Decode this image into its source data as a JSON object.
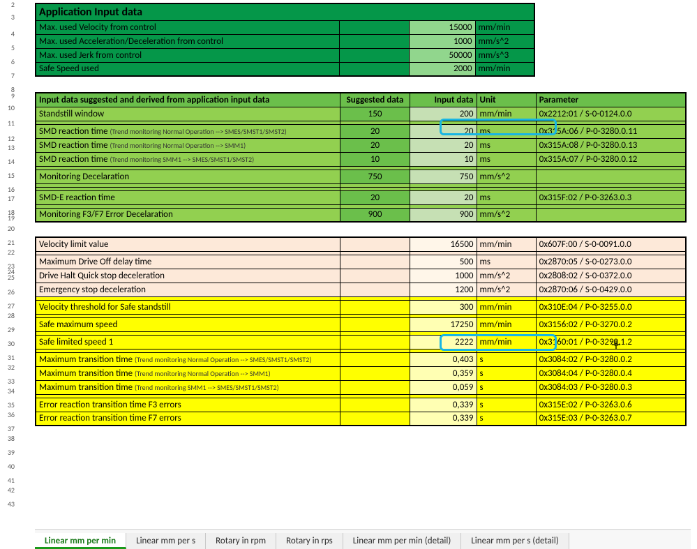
{
  "row_numbers": {
    "2": 0,
    "3": 14,
    "4": 38,
    "5": 58,
    "6": 78,
    "7": 98,
    "10": 156,
    "11": 178,
    "13": 212,
    "14": 232,
    "15": 252,
    "17": 286,
    "20": 330,
    "22": 364,
    "26": 434,
    "28": 468,
    "29": 488,
    "30": 508,
    "32": 542,
    "34": 576,
    "36": 610,
    "38": 644,
    "39": 664,
    "40": 684,
    "43": 740
  },
  "row_numbers_dense": {
    "8": 118,
    "9": 126,
    "12": 198,
    "16": 272,
    "18": 306,
    "19": 314,
    "21": 350,
    "23": 384,
    "24": 392,
    "25": 400,
    "27": 454,
    "31": 528,
    "33": 562,
    "35": 596,
    "37": 630,
    "41": 704,
    "42": 718
  },
  "appTitle": "Application Input data",
  "app": {
    "velocity": {
      "label": "Max. used Velocity from control",
      "value": "15000",
      "unit": "mm/min"
    },
    "accel": {
      "label": "Max. used Acceleration/Deceleration from control",
      "value": "1000",
      "unit": "mm/s^2"
    },
    "jerk": {
      "label": "Max. used Jerk from control",
      "value": "50000",
      "unit": "mm/s^3"
    },
    "safeSpeed": {
      "label": "Safe Speed used",
      "value": "2000",
      "unit": "mm/min"
    }
  },
  "derivedHeader": {
    "title": "Input data suggested and derived from application input data",
    "c1": "Suggested data",
    "c2": "Input data",
    "c3": "Unit",
    "c4": "Parameter"
  },
  "g": {
    "standstill": {
      "label": "Standstill window",
      "sug": "150",
      "inp": "200",
      "unit": "mm/min",
      "par": "0x2212:01 / S-0-0124.0.0"
    },
    "smd1": {
      "label": "SMD reaction time ",
      "note": "(Trend monitoring Normal Operation --> SMES/SMST1/SMST2)",
      "sug": "20",
      "inp": "20",
      "unit": "ms",
      "par": "0x315A:06 / P-0-3280.0.11"
    },
    "smd2": {
      "label": "SMD reaction time ",
      "note": "(Trend monitoring Normal Operation --> SMM1)",
      "sug": "20",
      "inp": "20",
      "unit": "ms",
      "par": "0x315A:08 / P-0-3280.0.13"
    },
    "smd3": {
      "label": "SMD reaction time ",
      "note": "(Trend monitoring SMM1 --> SMES/SMST1/SMST2)",
      "sug": "10",
      "inp": "10",
      "unit": "ms",
      "par": "0x315A:07 / P-0-3280.0.12"
    },
    "monDecel": {
      "label": "Monitoring Decelaration",
      "sug": "750",
      "inp": "750",
      "unit": "mm/s^2",
      "par": ""
    },
    "smde": {
      "label": "SMD-E reaction time",
      "sug": "20",
      "inp": "20",
      "unit": "ms",
      "par": "0x315F:02 / P-0-3263.0.3"
    },
    "monF3F7": {
      "label": "Monitoring F3/F7 Error Decelaration",
      "sug": "900",
      "inp": "900",
      "unit": "mm/s^2",
      "par": ""
    }
  },
  "b": {
    "velLimit": {
      "label": "Velocity limit value",
      "val": "16500",
      "unit": "mm/min",
      "par": "0x607F:00 / S-0-0091.0.0"
    },
    "maxOff": {
      "label": "Maximum Drive Off delay time",
      "val": "500",
      "unit": "ms",
      "par": "0x2870:05 / S-0-0273.0.0"
    },
    "haltQS": {
      "label": "Drive Halt Quick stop deceleration",
      "val": "1000",
      "unit": "mm/s^2",
      "par": "0x2808:02 / S-0-0372.0.0"
    },
    "emStop": {
      "label": "Emergency stop deceleration",
      "val": "1200",
      "unit": "mm/s^2",
      "par": "0x2870:06 / S-0-0429.0.0"
    }
  },
  "y": {
    "velThresh": {
      "label": "Velocity threshold for Safe standstill",
      "val": "300",
      "unit": "mm/min",
      "par": "0x310E:04 / P-0-3255.0.0"
    },
    "safeMax": {
      "label": "Safe maximum speed",
      "val": "17250",
      "unit": "mm/min",
      "par": "0x3156:02 / P-0-3270.0.2"
    },
    "safeLim1": {
      "label": "Safe limited speed 1",
      "val": "2222",
      "unit": "mm/min",
      "par": "0x3160:01 / P-0-3290.1.2"
    },
    "mtt1": {
      "label": "Maximum transition time ",
      "note": "(Trend monitoring Normal Operation --> SMES/SMST1/SMST2)",
      "val": "0,403",
      "unit": "s",
      "par": "0x3084:02 / P-0-3280.0.2"
    },
    "mtt2": {
      "label": "Maximum transition time ",
      "note": "(Trend monitoring Normal Operation --> SMM1)",
      "val": "0,359",
      "unit": "s",
      "par": "0x3084:04 / P-0-3280.0.4"
    },
    "mtt3": {
      "label": "Maximum transition time ",
      "note": "(Trend monitoring SMM1 --> SMES/SMST1/SMST2)",
      "val": "0,059",
      "unit": "s",
      "par": "0x3084:03 / P-0-3280.0.3"
    },
    "errF3": {
      "label": "Error reaction transition time F3 errors",
      "val": "0,339",
      "unit": "s",
      "par": "0x315E:02 / P-0-3263.0.6"
    },
    "errF7": {
      "label": "Error reaction transition time F7 errors",
      "val": "0,339",
      "unit": "s",
      "par": "0x315E:03 / P-0-3263.0.7"
    }
  },
  "tabs": {
    "t0": "Linear mm per min",
    "t1": "Linear mm per s",
    "t2": "Rotary in rpm",
    "t3": "Rotary in rps",
    "t4": "Linear mm per min (detail)",
    "t5": "Linear mm per s (detail)"
  }
}
